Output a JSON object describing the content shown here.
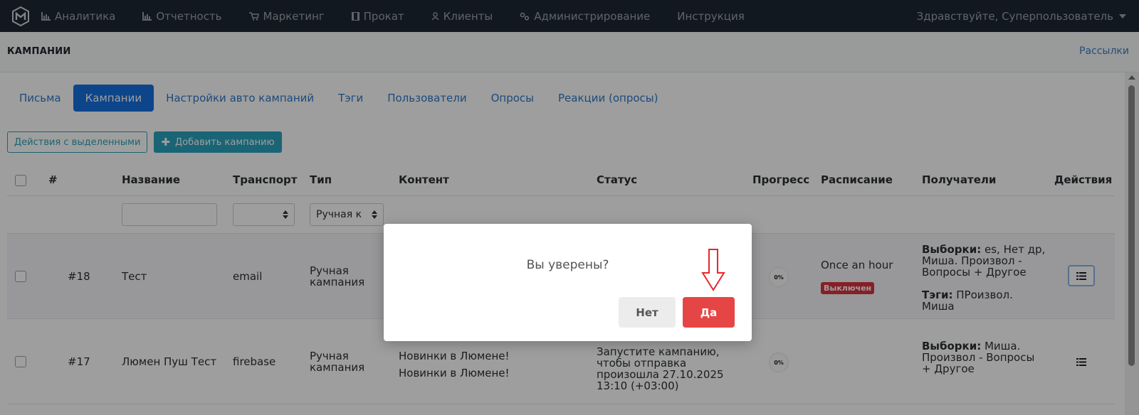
{
  "nav": {
    "items": [
      {
        "label": "Аналитика",
        "icon": "bar-chart-icon"
      },
      {
        "label": "Отчетность",
        "icon": "bar-chart-icon"
      },
      {
        "label": "Маркетинг",
        "icon": "cart-icon"
      },
      {
        "label": "Прокат",
        "icon": "film-icon"
      },
      {
        "label": "Клиенты",
        "icon": "user-icon"
      },
      {
        "label": "Администрирование",
        "icon": "gears-icon"
      },
      {
        "label": "Инструкция",
        "icon": ""
      }
    ],
    "user_greeting": "Здравствуйте, Суперпользователь"
  },
  "subheader": {
    "title": "КАМПАНИИ",
    "link": "Рассылки"
  },
  "tabs": [
    {
      "label": "Письма",
      "active": false
    },
    {
      "label": "Кампании",
      "active": true
    },
    {
      "label": "Настройки авто кампаний",
      "active": false
    },
    {
      "label": "Тэги",
      "active": false
    },
    {
      "label": "Пользователи",
      "active": false
    },
    {
      "label": "Опросы",
      "active": false
    },
    {
      "label": "Реакции (опросы)",
      "active": false
    }
  ],
  "toolbar": {
    "bulk_label": "Действия с выделенными",
    "add_label": "Добавить кампанию"
  },
  "table": {
    "columns": {
      "num": "#",
      "name": "Название",
      "transport": "Транспорт",
      "type": "Тип",
      "content": "Контент",
      "status": "Статус",
      "progress": "Прогресс",
      "schedule": "Расписание",
      "recipients": "Получатели",
      "actions": "Действия"
    },
    "filters": {
      "name_value": "",
      "transport_value": "",
      "type_value": "Ручная к"
    },
    "rows": [
      {
        "num": "#18",
        "name": "Тест",
        "transport": "email",
        "type_line1": "Ручная",
        "type_line2": "кампания",
        "progress": "0%",
        "schedule": "Once an hour",
        "schedule_badge": "Выключен",
        "recipients_sel_label": "Выборки:",
        "recipients_sel_value": "es, Нет др,",
        "recipients_sel_line2": "Миша. Произвол -",
        "recipients_sel_line3": "Вопросы + Другое",
        "recipients_tags_label": "Тэги:",
        "recipients_tags_value": "ПРоизвол.",
        "recipients_tags_line2": "Миша"
      },
      {
        "num": "#17",
        "name": "Люмен Пуш Тест",
        "transport": "firebase",
        "type_line1": "Ручная",
        "type_line2": "кампания",
        "content_line1": "Новинки в Люмене!",
        "content_line2": "Новинки в Люмене!",
        "status_line1": "Запустите кампанию,",
        "status_line2": "чтобы отправка",
        "status_line3": "произошла 27.10.2025",
        "status_line4": "13:10 (+03:00)",
        "progress": "0%",
        "recipients_sel_label": "Выборки:",
        "recipients_sel_value": "Миша.",
        "recipients_sel_line2": "Произвол - Вопросы",
        "recipients_sel_line3": "+ Другое"
      }
    ]
  },
  "modal": {
    "question": "Вы уверены?",
    "no_label": "Нет",
    "yes_label": "Да"
  },
  "colors": {
    "navbar": "#1e2732",
    "primary": "#1670e0",
    "teal": "#29a3bd",
    "danger": "#e64545",
    "badge_off": "#d9333f"
  }
}
